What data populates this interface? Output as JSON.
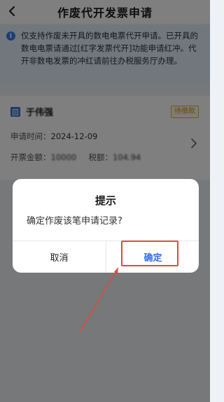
{
  "header": {
    "title": "作废代开发票申请"
  },
  "notice": {
    "icon": "info-icon",
    "text": "仅支持作废未开具的数电电票代开申请。已开具的数电电票请通过[红字发票代开]功能申请红冲。代开非数电发票的冲红请前往办税服务厅办理。"
  },
  "card": {
    "name": "于伟强",
    "status": "待缴款",
    "apply_time_label": "申请时间：",
    "apply_time_value": "2024-12-09",
    "amount_label": "开票金额：",
    "amount_value": "10000",
    "tax_label": "税额：",
    "tax_value": "104.94"
  },
  "dialog": {
    "title": "提示",
    "message": "确定作废该笔申请记录?",
    "cancel_label": "取消",
    "confirm_label": "确定"
  },
  "colors": {
    "accent": "#2f6ee6",
    "highlight": "#e04a3a",
    "badge": "#e2b23a"
  }
}
